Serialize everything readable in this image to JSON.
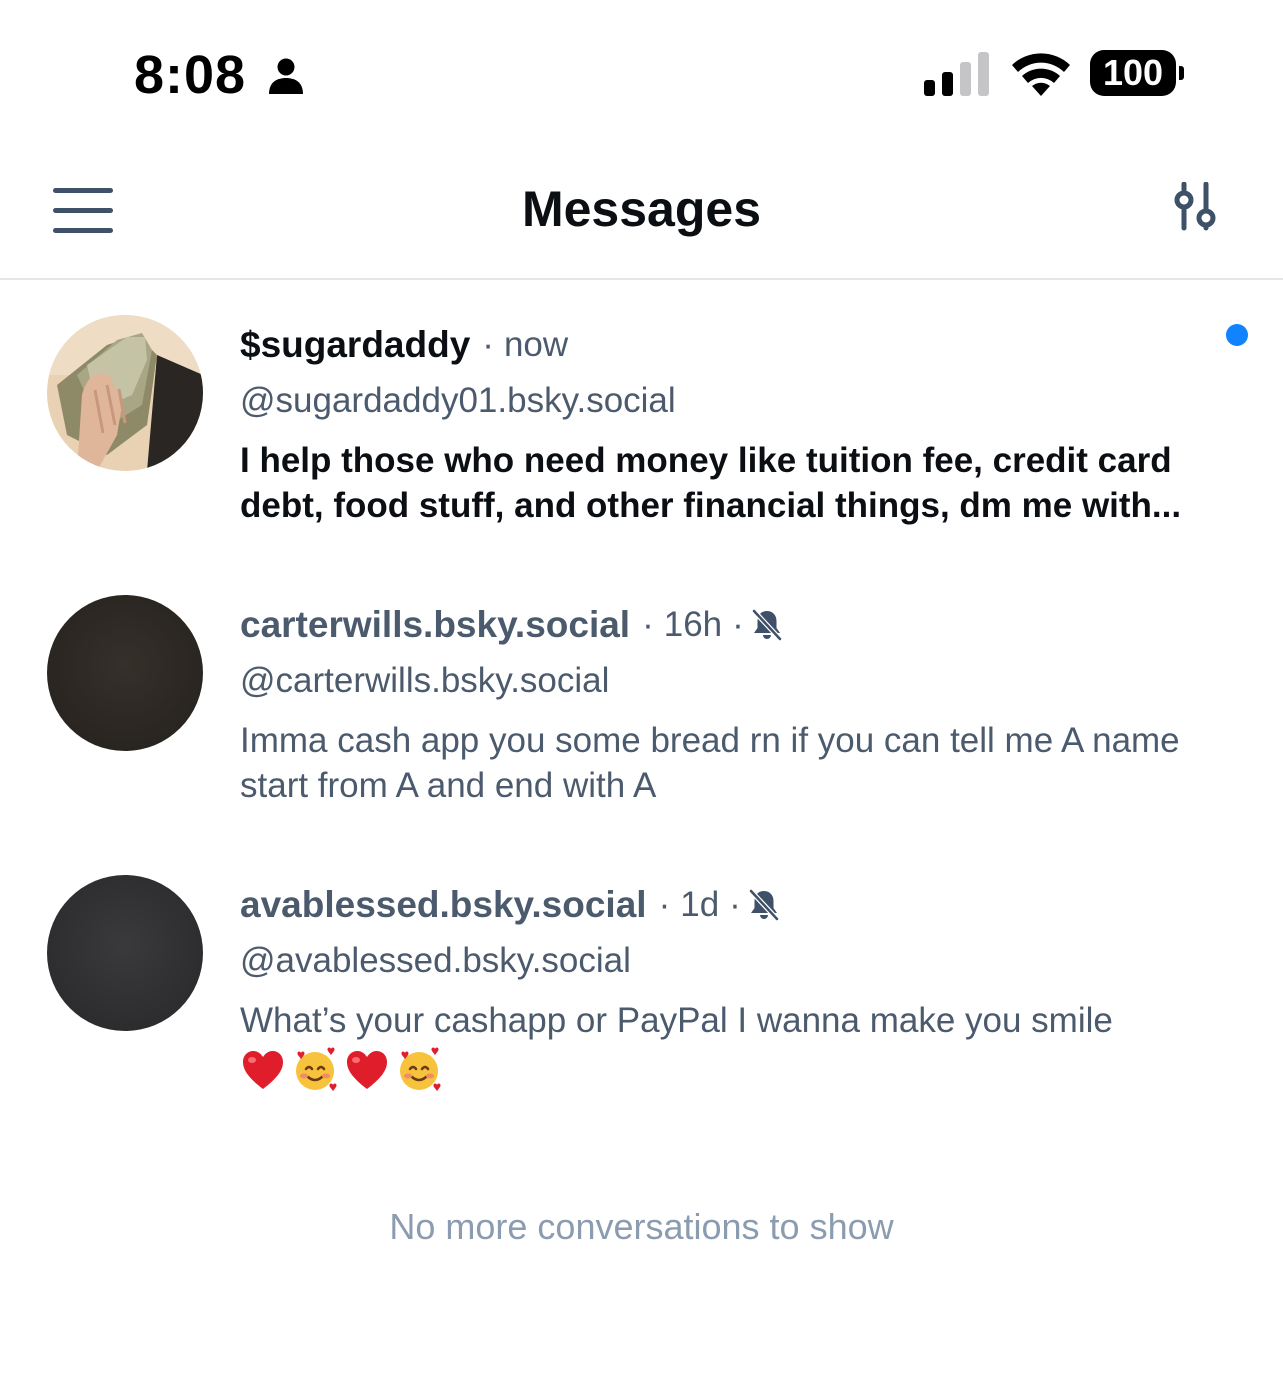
{
  "status_bar": {
    "time": "8:08",
    "battery": "100"
  },
  "header": {
    "title": "Messages"
  },
  "conversations": [
    {
      "name": "$sugardaddy",
      "time": "now",
      "handle": "@sugardaddy01.bsky.social",
      "preview": "I help those who need money like tuition fee, credit card debt, food stuff, and other financial things, dm me with...",
      "unread": true,
      "muted": false
    },
    {
      "name": "carterwills.bsky.social",
      "time": "16h",
      "handle": "@carterwills.bsky.social",
      "preview": "Imma cash app you some bread rn if you can tell me A name start from A and end with A",
      "unread": false,
      "muted": true
    },
    {
      "name": "avablessed.bsky.social",
      "time": "1d",
      "handle": "@avablessed.bsky.social",
      "preview": "What’s your cashapp or PayPal I wanna make you smile",
      "emoji": [
        "red-heart",
        "smiling-face-with-hearts",
        "red-heart",
        "smiling-face-with-hearts"
      ],
      "unread": false,
      "muted": true
    }
  ],
  "footer": {
    "end_text": "No more conversations to show"
  },
  "icons": {
    "menu": "hamburger-menu-icon",
    "settings": "sliders-icon",
    "mute": "bell-off-icon",
    "person": "person-icon"
  },
  "colors": {
    "unread_dot": "#1083fe",
    "muted_text": "#4b5a6c",
    "end_text": "#8b9cb0",
    "icon": "#3e5168"
  }
}
